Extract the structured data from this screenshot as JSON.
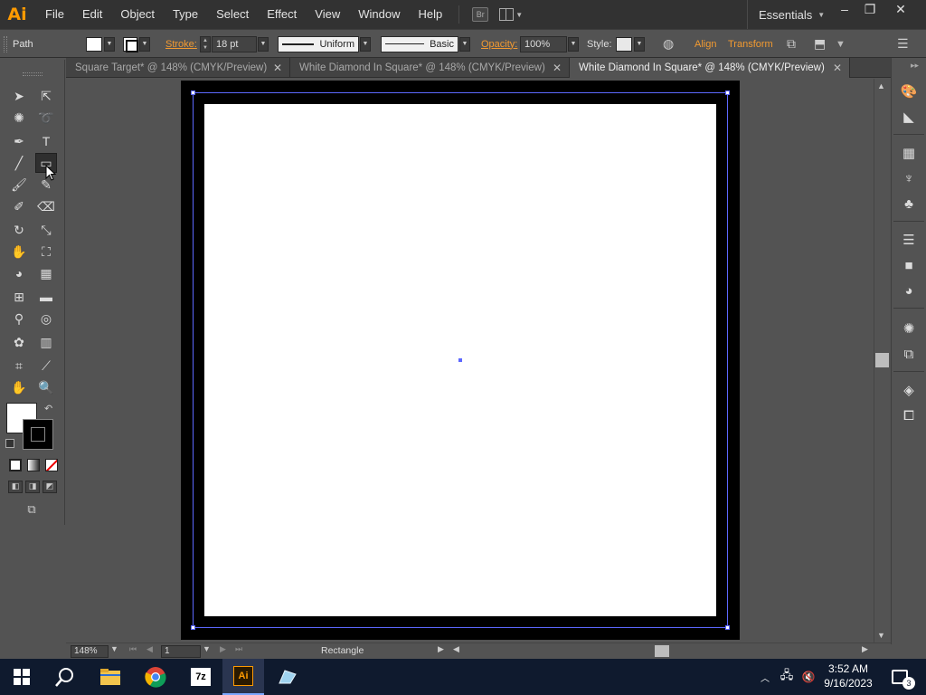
{
  "app": {
    "logo": "Ai",
    "accent": "#ff9a00"
  },
  "menu": {
    "items": [
      "File",
      "Edit",
      "Object",
      "Type",
      "Select",
      "Effect",
      "View",
      "Window",
      "Help"
    ],
    "bridge_label": "Br",
    "workspace": "Essentials"
  },
  "window_controls": {
    "minimize": "–",
    "restore": "❐",
    "close": "✕"
  },
  "controlbar": {
    "selection_label": "Path",
    "stroke_label": "Stroke:",
    "stroke_weight": "18 pt",
    "profile_label": "Uniform",
    "brush_label": "Basic",
    "opacity_label": "Opacity:",
    "opacity_value": "100%",
    "style_label": "Style:",
    "align_label": "Align",
    "transform_label": "Transform"
  },
  "tabs": [
    {
      "label": "Square Target* @ 148% (CMYK/Preview)",
      "close": "✕",
      "active": false
    },
    {
      "label": "White Diamond In Square* @ 148% (CMYK/Preview)",
      "close": "✕",
      "active": false
    },
    {
      "label": "White Diamond In Square* @ 148% (CMYK/Preview)",
      "close": "✕",
      "active": true
    }
  ],
  "tools": [
    "selection-tool-icon",
    "direct-selection-tool-icon",
    "magic-wand-tool-icon",
    "lasso-tool-icon",
    "pen-tool-icon",
    "type-tool-icon",
    "line-segment-tool-icon",
    "rectangle-tool-icon",
    "paintbrush-tool-icon",
    "pencil-tool-icon",
    "blob-brush-tool-icon",
    "eraser-tool-icon",
    "rotate-tool-icon",
    "scale-tool-icon",
    "warp-tool-icon",
    "free-transform-tool-icon",
    "shape-builder-tool-icon",
    "perspective-grid-tool-icon",
    "mesh-tool-icon",
    "gradient-tool-icon",
    "eyedropper-tool-icon",
    "blend-tool-icon",
    "symbol-sprayer-tool-icon",
    "column-graph-tool-icon",
    "artboard-tool-icon",
    "slice-tool-icon",
    "hand-tool-icon",
    "zoom-tool-icon"
  ],
  "active_tool": "rectangle-tool-icon",
  "canvas": {
    "artboard_color": "#ffffff",
    "frame_color": "#000000",
    "selection_color": "#5d68ff"
  },
  "statusbar": {
    "zoom": "148%",
    "artboard_number": "1",
    "current_tool": "Rectangle"
  },
  "dock_icons": [
    "color-guide-icon",
    "color-icon",
    "swatches-icon",
    "brushes-icon",
    "symbols-icon",
    "stroke-icon",
    "gradient-icon",
    "transparency-icon",
    "appearance-icon",
    "graphic-styles-icon",
    "layers-icon",
    "artboards-icon"
  ],
  "taskbar": {
    "items": [
      "start-icon",
      "search-icon",
      "file-explorer-icon",
      "chrome-icon",
      "7zip-icon",
      "illustrator-icon",
      "app-icon"
    ],
    "time": "3:52 AM",
    "date": "9/16/2023",
    "notifications": "3"
  }
}
